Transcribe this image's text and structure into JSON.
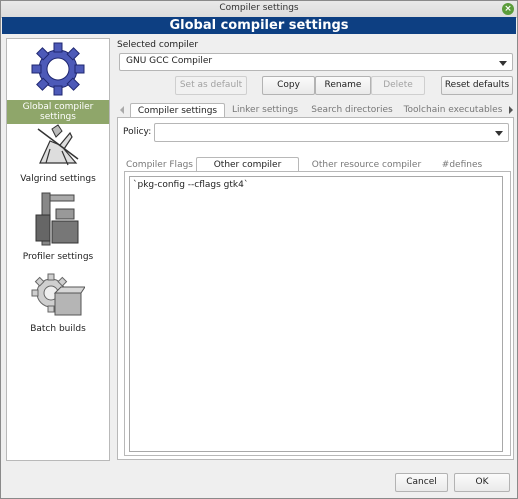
{
  "window": {
    "title": "Compiler settings",
    "header": "Global compiler settings",
    "close_glyph": "×"
  },
  "sidebar": {
    "items": [
      {
        "label": "Global compiler settings",
        "icon": "gear-icon",
        "active": true
      },
      {
        "label": "Valgrind settings",
        "icon": "knight-icon",
        "active": false
      },
      {
        "label": "Profiler settings",
        "icon": "caliper-icon",
        "active": false
      },
      {
        "label": "Batch builds",
        "icon": "gear-box-icon",
        "active": false
      }
    ]
  },
  "compiler": {
    "selected_label": "Selected compiler",
    "selected_value": "GNU GCC Compiler",
    "buttons": {
      "set_default": "Set as default",
      "copy": "Copy",
      "rename": "Rename",
      "delete": "Delete",
      "reset": "Reset defaults"
    }
  },
  "tabs": [
    "Compiler settings",
    "Linker settings",
    "Search directories",
    "Toolchain executables"
  ],
  "policy": {
    "label": "Policy:",
    "value": ""
  },
  "subtabs": [
    "Compiler Flags",
    "Other compiler options",
    "Other resource compiler options",
    "#defines"
  ],
  "options_text": "`pkg-config --cflags gtk4`",
  "footer": {
    "cancel": "Cancel",
    "ok": "OK"
  }
}
